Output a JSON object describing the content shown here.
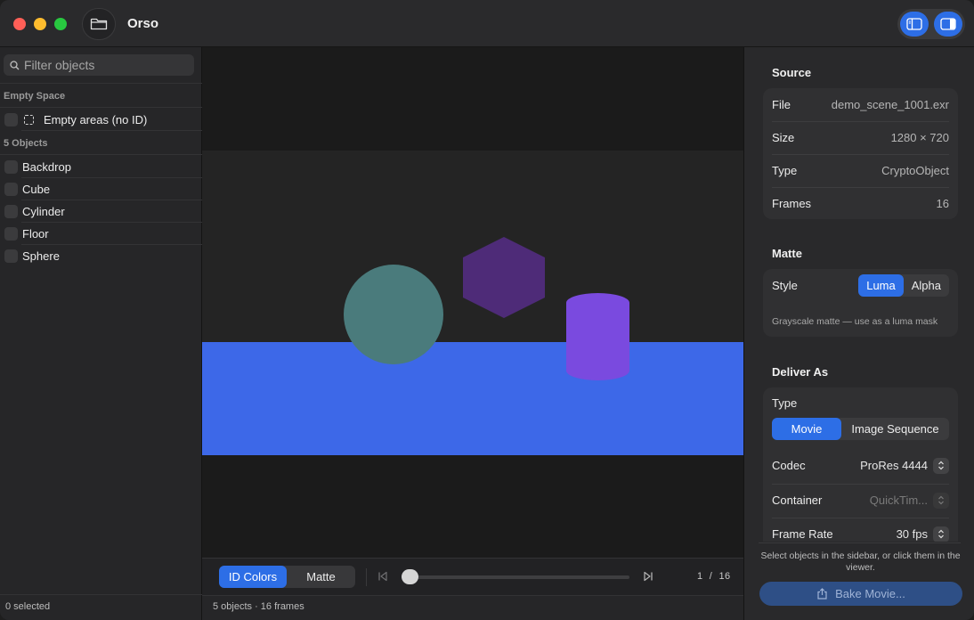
{
  "app": {
    "title": "Orso"
  },
  "sidebar": {
    "filter_placeholder": "Filter objects",
    "empty_section": "Empty Space",
    "empty_item": "Empty areas (no ID)",
    "objects_section": "5 Objects",
    "objects": [
      {
        "label": "Backdrop"
      },
      {
        "label": "Cube"
      },
      {
        "label": "Cylinder"
      },
      {
        "label": "Floor"
      },
      {
        "label": "Sphere"
      }
    ],
    "footer": "0 selected"
  },
  "viewer": {
    "colors": {
      "background": "#242424",
      "floor": "#3d68e8",
      "sphere": "#4a7b7c",
      "cube": "#4e2b78",
      "cylinder": "#7a4adf"
    },
    "view_modes": [
      "ID Colors",
      "Matte"
    ],
    "active_view_mode": "ID Colors",
    "frame_current": "1",
    "frame_sep": "/",
    "frame_total": "16",
    "status": "5 objects · 16 frames"
  },
  "inspector": {
    "source": {
      "heading": "Source",
      "rows": [
        {
          "key": "File",
          "value": "demo_scene_1001.exr"
        },
        {
          "key": "Size",
          "value": "1280 × 720"
        },
        {
          "key": "Type",
          "value": "CryptoObject"
        },
        {
          "key": "Frames",
          "value": "16"
        }
      ]
    },
    "matte": {
      "heading": "Matte",
      "style_label": "Style",
      "options": [
        "Luma",
        "Alpha"
      ],
      "active": "Luma",
      "hint": "Grayscale matte — use as a luma mask"
    },
    "deliver": {
      "heading": "Deliver As",
      "type_label": "Type",
      "type_options": [
        "Movie",
        "Image Sequence"
      ],
      "type_active": "Movie",
      "codec_label": "Codec",
      "codec_value": "ProRes 4444",
      "container_label": "Container",
      "container_value": "QuickTim...",
      "framerate_label": "Frame Rate",
      "framerate_value": "30 fps"
    },
    "help": "Select objects in the sidebar, or click them in the viewer.",
    "bake_label": "Bake Movie..."
  },
  "accent": "#2d6ee6"
}
